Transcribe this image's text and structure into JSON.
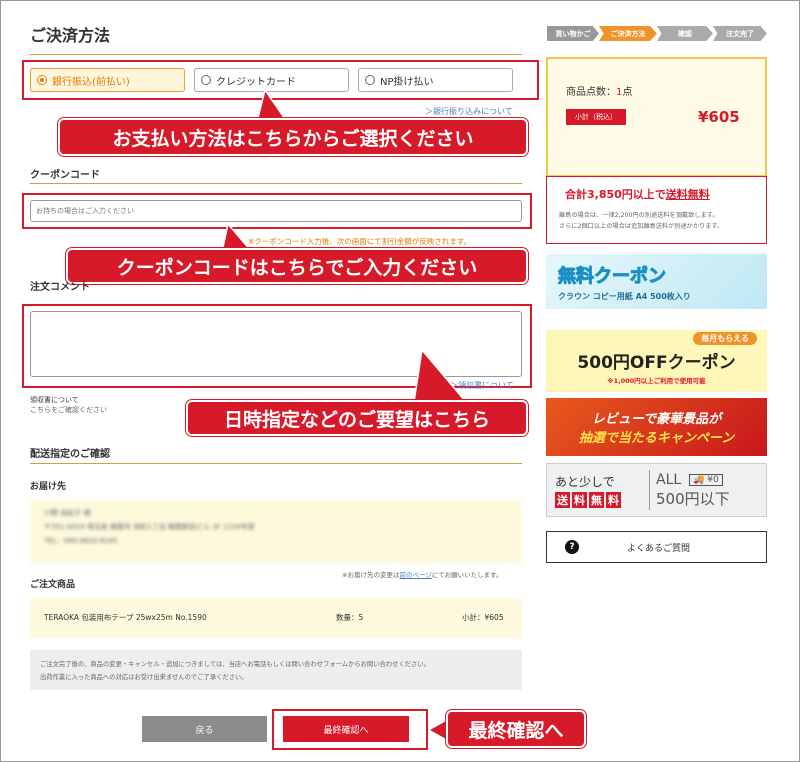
{
  "page": {
    "title": "ご決済方法"
  },
  "breadcrumb": [
    "買い物かご",
    "ご決済方法",
    "確認",
    "注文完了"
  ],
  "payment": {
    "options": [
      {
        "label": "銀行振込(前払い)",
        "selected": true
      },
      {
        "label": "クレジットカード",
        "selected": false
      },
      {
        "label": "NP掛け払い",
        "selected": false
      }
    ],
    "link": "＞銀行振り込みについて",
    "callout": "お支払い方法はこちらからご選択ください"
  },
  "coupon": {
    "heading": "クーポンコード",
    "placeholder": "お持ちの場合はご入力ください",
    "note": "※クーポンコード入力後、次の画面にて割引金額が反映されます。",
    "callout": "クーポンコードはこちらでご入力ください"
  },
  "comment": {
    "heading": "注文コメント",
    "link": "＞領収書について",
    "receipt_heading": "領収書について",
    "receipt_note": "こちらをご確認ください",
    "callout": "日時指定などのご要望はこちら"
  },
  "delivery": {
    "heading": "配送指定のご確認",
    "address_heading": "お届け先",
    "address_lines": [
      "川野 由紀子 様",
      "〒351-0024 埼玉県 朝霞市 栄町1丁目 朝霞駅前ビル 3F 1234号室",
      "TEL：090-9620-8185"
    ],
    "change_note_before": "※お届け先の変更は",
    "change_note_link": "前のページ",
    "change_note_after": "にてお願いいたします。",
    "items_heading": "ご注文商品",
    "item": {
      "name": "TERAOKA 包装用布テープ 25wx25m No.1590",
      "qty": "数量：5",
      "subtotal": "小計：¥605"
    }
  },
  "notice": {
    "lines": [
      "ご注文完了後の、商品の変更・キャンセル・追加につきましては、当店へお電話もしくは問い合わせフォームからお問い合わせください。",
      "出荷作業に入った商品への対応はお受け出来ませんのでご了承ください。"
    ]
  },
  "buttons": {
    "back": "戻る",
    "confirm": "最終確認へ",
    "callout": "最終確認へ"
  },
  "summary": {
    "count_label": "商品点数：",
    "count": "1",
    "count_unit": "点",
    "subtotal_label": "小計（税込）",
    "subtotal": "¥605"
  },
  "shipping": {
    "title_a": "合計3,850円以上で",
    "title_b": "送料無料",
    "lines": [
      "離島の場合は、一律2,200円の別途送料を頂戴致します。",
      "さらに2個口以上の場合は追加離島送料が別途かかります。"
    ]
  },
  "banners": {
    "coupon_title": "無料クーポン",
    "coupon_sub": "クラウン コピー用紙 A4 500枚入り",
    "off_badge": "毎月もらえる",
    "off_title": "500円OFFクーポン",
    "off_note": "※1,000円以上ご利用で使用可能",
    "review_line1": "レビューで豪華景品が",
    "review_line2": "抽選で当たるキャンペーン",
    "ship_line1": "あと少しで",
    "ship_tags": [
      "送",
      "料",
      "無",
      "料"
    ],
    "ship_all": "ALL",
    "ship_price": "500円以下",
    "ship_zero": "¥0"
  },
  "faq": {
    "icon": "?",
    "label": "よくあるご質問"
  },
  "colors": {
    "accent": "#d61a2a",
    "orange": "#e27d00",
    "gold": "#c9a24a",
    "summary_bg": "#fffbe6",
    "summary_border": "#f3c84a"
  }
}
